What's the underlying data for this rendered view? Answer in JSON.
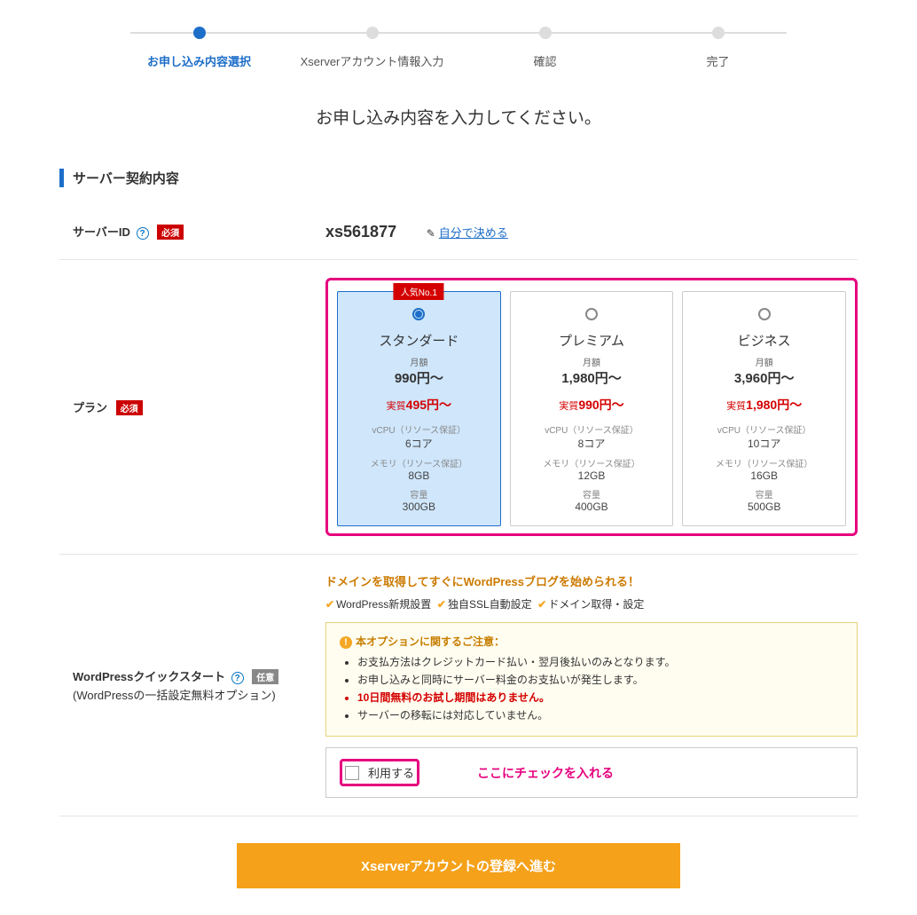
{
  "steps": [
    {
      "label": "お申し込み内容選択",
      "active": true
    },
    {
      "label": "Xserverアカウント情報入力",
      "active": false
    },
    {
      "label": "確認",
      "active": false
    },
    {
      "label": "完了",
      "active": false
    }
  ],
  "page_title": "お申し込み内容を入力してください。",
  "section_title": "サーバー契約内容",
  "labels": {
    "server_id": "サーバーID",
    "plan": "プラン",
    "quickstart": "WordPressクイックスタート",
    "quickstart_sub": "(WordPressの一括設定無料オプション)",
    "required": "必須",
    "optional": "任意",
    "decide_yourself": "自分で決める",
    "monthly": "月額",
    "actual_prefix": "実質",
    "vcpu_label": "vCPU（リソース保証）",
    "mem_label": "メモリ（リソース保証）",
    "storage_label": "容量",
    "popular": "人気No.1",
    "use_label": "利用する"
  },
  "server_id_value": "xs561877",
  "plans": [
    {
      "name": "スタンダード",
      "price": "990円～",
      "actual": "495円～",
      "cpu": "6コア",
      "mem": "8GB",
      "storage": "300GB",
      "popular": true,
      "selected": true
    },
    {
      "name": "プレミアム",
      "price": "1,980円～",
      "actual": "990円～",
      "cpu": "8コア",
      "mem": "12GB",
      "storage": "400GB",
      "popular": false,
      "selected": false
    },
    {
      "name": "ビジネス",
      "price": "3,960円～",
      "actual": "1,980円～",
      "cpu": "10コア",
      "mem": "16GB",
      "storage": "500GB",
      "popular": false,
      "selected": false
    }
  ],
  "promo": {
    "headline": "ドメインを取得してすぐにWordPressブログを始められる！",
    "features": [
      "WordPress新規設置",
      "独自SSL自動設定",
      "ドメイン取得・設定"
    ]
  },
  "notice": {
    "title": "本オプションに関するご注意：",
    "items": [
      {
        "text": "お支払方法はクレジットカード払い・翌月後払いのみとなります。",
        "red": false
      },
      {
        "text": "お申し込みと同時にサーバー料金のお支払いが発生します。",
        "red": false
      },
      {
        "text": "10日間無料のお試し期間はありません。",
        "red": true
      },
      {
        "text": "サーバーの移転には対応していません。",
        "red": false
      }
    ]
  },
  "annotation": "ここにチェックを入れる",
  "cta": "Xserverアカウントの登録へ進む"
}
